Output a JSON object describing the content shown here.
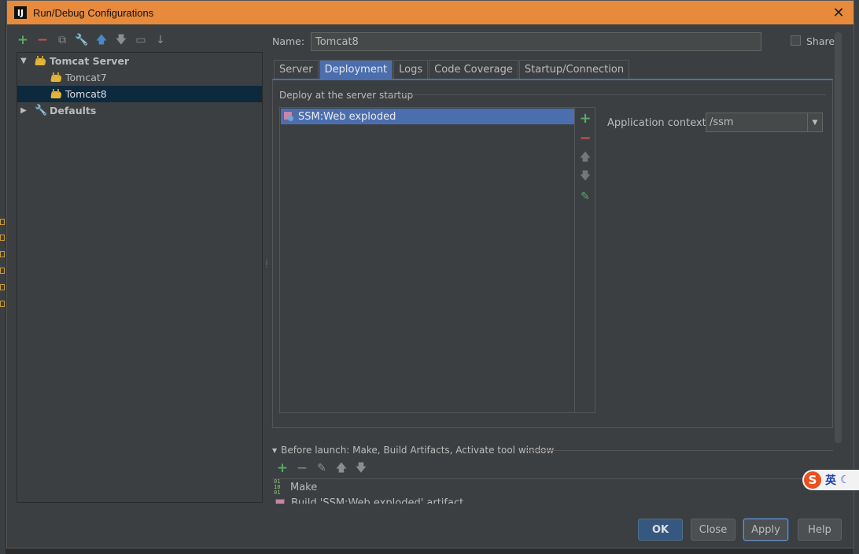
{
  "window": {
    "title": "Run/Debug Configurations",
    "app_icon": "IJ"
  },
  "left_toolbar": [
    "add-icon",
    "remove-icon",
    "copy-icon",
    "edit-defaults-icon",
    "move-up-icon",
    "move-down-icon",
    "folder-icon",
    "sort-icon"
  ],
  "tree": {
    "root": {
      "label": "Tomcat Server",
      "expanded": true
    },
    "children": [
      {
        "label": "Tomcat7",
        "selected": false
      },
      {
        "label": "Tomcat8",
        "selected": true
      }
    ],
    "defaults": {
      "label": "Defaults",
      "expanded": false
    }
  },
  "name_field": {
    "label": "Name:",
    "value": "Tomcat8"
  },
  "share": {
    "label": "Share",
    "checked": false
  },
  "tabs": [
    {
      "label": "Server",
      "active": false
    },
    {
      "label": "Deployment",
      "active": true
    },
    {
      "label": "Logs",
      "active": false
    },
    {
      "label": "Code Coverage",
      "active": false
    },
    {
      "label": "Startup/Connection",
      "active": false
    }
  ],
  "deployment": {
    "section_label": "Deploy at the server startup",
    "artifacts": [
      "SSM:Web exploded"
    ],
    "app_context_label": "Application context:",
    "app_context_value": "/ssm"
  },
  "before_launch": {
    "header": "Before launch: Make, Build Artifacts, Activate tool window",
    "items": [
      "Make",
      "Build 'SSM:Web exploded' artifact"
    ]
  },
  "buttons": {
    "ok": "OK",
    "close": "Close",
    "apply": "Apply",
    "help": "Help"
  },
  "ime": {
    "logo": "S",
    "lang": "英"
  },
  "colors": {
    "titlebar": "#e88a3c",
    "selection": "#4b6eaf",
    "tree_selection": "#0d293e",
    "add": "#59a869",
    "remove": "#c75450"
  }
}
